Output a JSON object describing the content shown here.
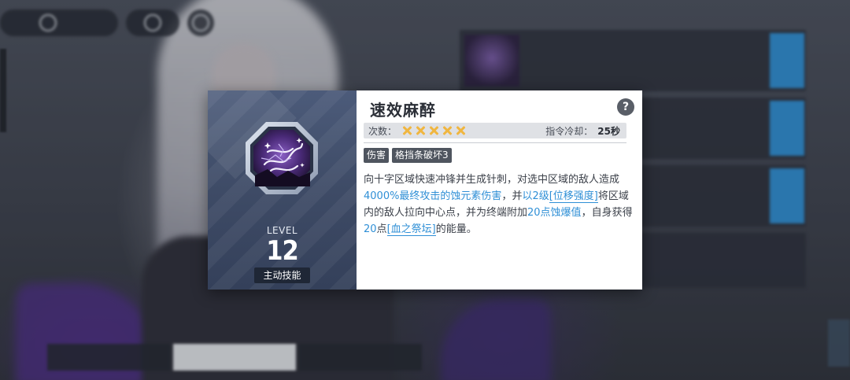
{
  "skill_popup": {
    "name": "速效麻醉",
    "help_glyph": "?",
    "level_label": "LEVEL",
    "level_value": "12",
    "skill_type": "主动技能",
    "charges_label": "次数：",
    "charges_count": 5,
    "charge_color": "#f0b640",
    "cooldown_label": "指令冷却：",
    "cooldown_value": "25秒",
    "tags": [
      "伤害",
      "格挡条破坏3"
    ],
    "description": {
      "seg1": "向十字区域快速冲锋并生成针刺，对选中区域的敌人造成",
      "seg2": "4000%最终攻击的蚀元素伤害",
      "seg3": "，并",
      "seg4": "以2级",
      "seg5": "[位移强度]",
      "seg6": "将区域内的敌人拉向中心点，并为终端附加",
      "seg7": "20点蚀爆值",
      "seg8": "，自身获得",
      "seg9": "20",
      "seg10": "点",
      "seg11": "[血之祭坛]",
      "seg12": "的能量。"
    },
    "accent_color": "#2f8fd6",
    "icon": "purple-lightning-skill-icon"
  },
  "accent_button_color": "#2b8fd6"
}
